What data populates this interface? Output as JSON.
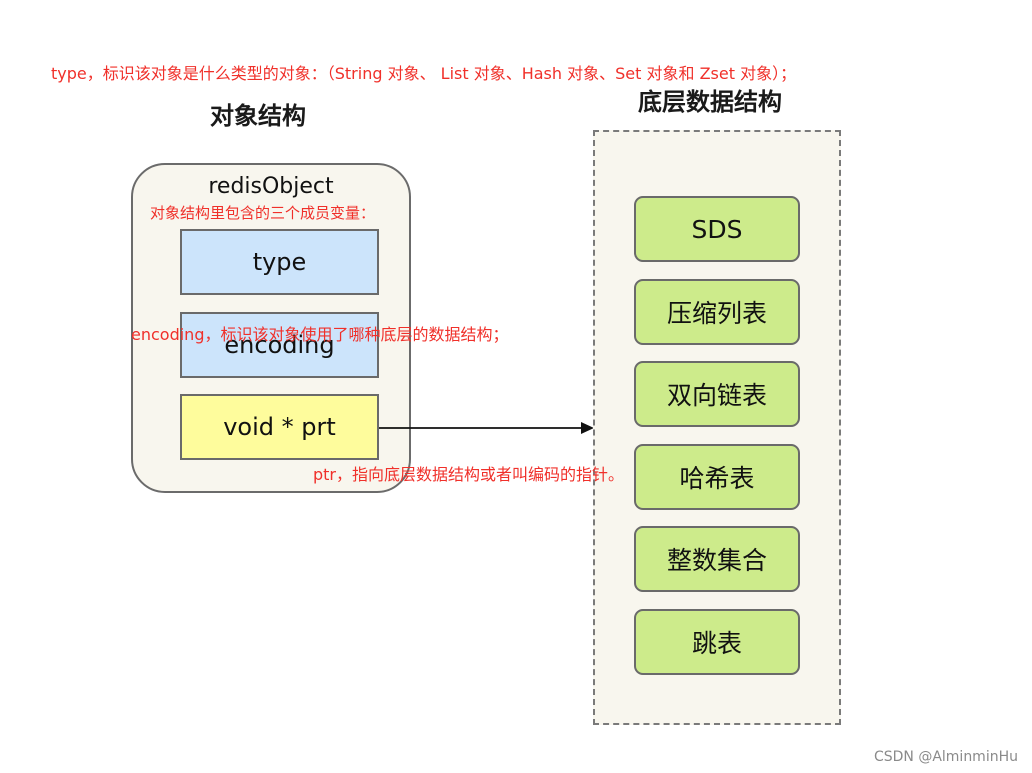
{
  "annotations": {
    "type_note": "type，标识该对象是什么类型的对象：（String 对象、 List 对象、Hash 对象、Set 对象和 Zset 对象）；",
    "members_note": "对象结构里包含的三个成员变量：",
    "encoding_note": "encoding，标识该对象使用了哪种底层的数据结构；",
    "ptr_note": "ptr，指向底层数据结构或者叫编码的指针。"
  },
  "object_structure": {
    "heading": "对象结构",
    "title": "redisObject",
    "fields": [
      {
        "label": "type",
        "color": "#cce4fb"
      },
      {
        "label": "encoding",
        "color": "#cce4fb"
      },
      {
        "label": "void * prt",
        "color": "#fefc9c"
      }
    ]
  },
  "underlying_structures": {
    "heading": "底层数据结构",
    "items": [
      "SDS",
      "压缩列表",
      "双向链表",
      "哈希表",
      "整数集合",
      "跳表"
    ],
    "item_color": "#cdeb8b"
  },
  "colors": {
    "annotation": "#f0302a",
    "container_bg": "#f8f6ee"
  },
  "watermark": "CSDN @AlminminHu"
}
